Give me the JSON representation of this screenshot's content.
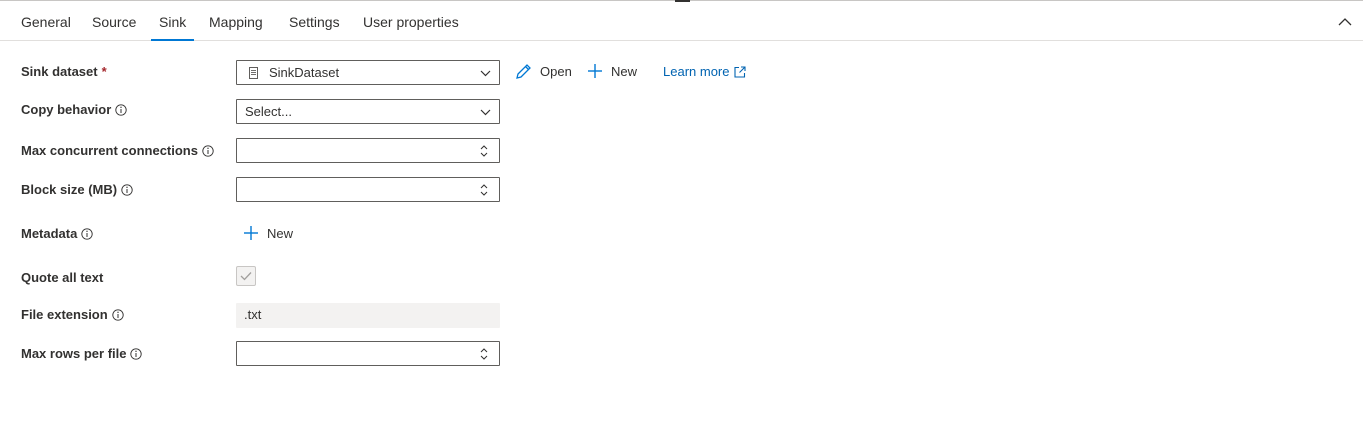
{
  "tabs": [
    {
      "label": "General"
    },
    {
      "label": "Source"
    },
    {
      "label": "Sink"
    },
    {
      "label": "Mapping"
    },
    {
      "label": "Settings"
    },
    {
      "label": "User properties"
    }
  ],
  "active_tab": "Sink",
  "form": {
    "sink_dataset": {
      "label": "Sink dataset",
      "required_mark": "*",
      "value": "SinkDataset"
    },
    "actions": {
      "open": "Open",
      "new": "New",
      "learn_more": "Learn more"
    },
    "copy_behavior": {
      "label": "Copy behavior",
      "placeholder": "Select..."
    },
    "max_concurrent": {
      "label": "Max concurrent connections",
      "value": ""
    },
    "block_size": {
      "label": "Block size (MB)",
      "value": ""
    },
    "metadata": {
      "label": "Metadata",
      "new_label": "New"
    },
    "quote_all_text": {
      "label": "Quote all text",
      "checked": true
    },
    "file_extension": {
      "label": "File extension",
      "value": ".txt"
    },
    "max_rows": {
      "label": "Max rows per file",
      "value": ""
    }
  },
  "colors": {
    "accent": "#0078d4",
    "link": "#0063b1",
    "required": "#a4262c"
  },
  "icons": [
    "collapse-up-icon",
    "info-icon",
    "dataset-file-icon",
    "chevron-down-icon",
    "pencil-icon",
    "plus-icon",
    "external-link-icon",
    "spinner-arrows-icon",
    "checkmark-icon"
  ]
}
